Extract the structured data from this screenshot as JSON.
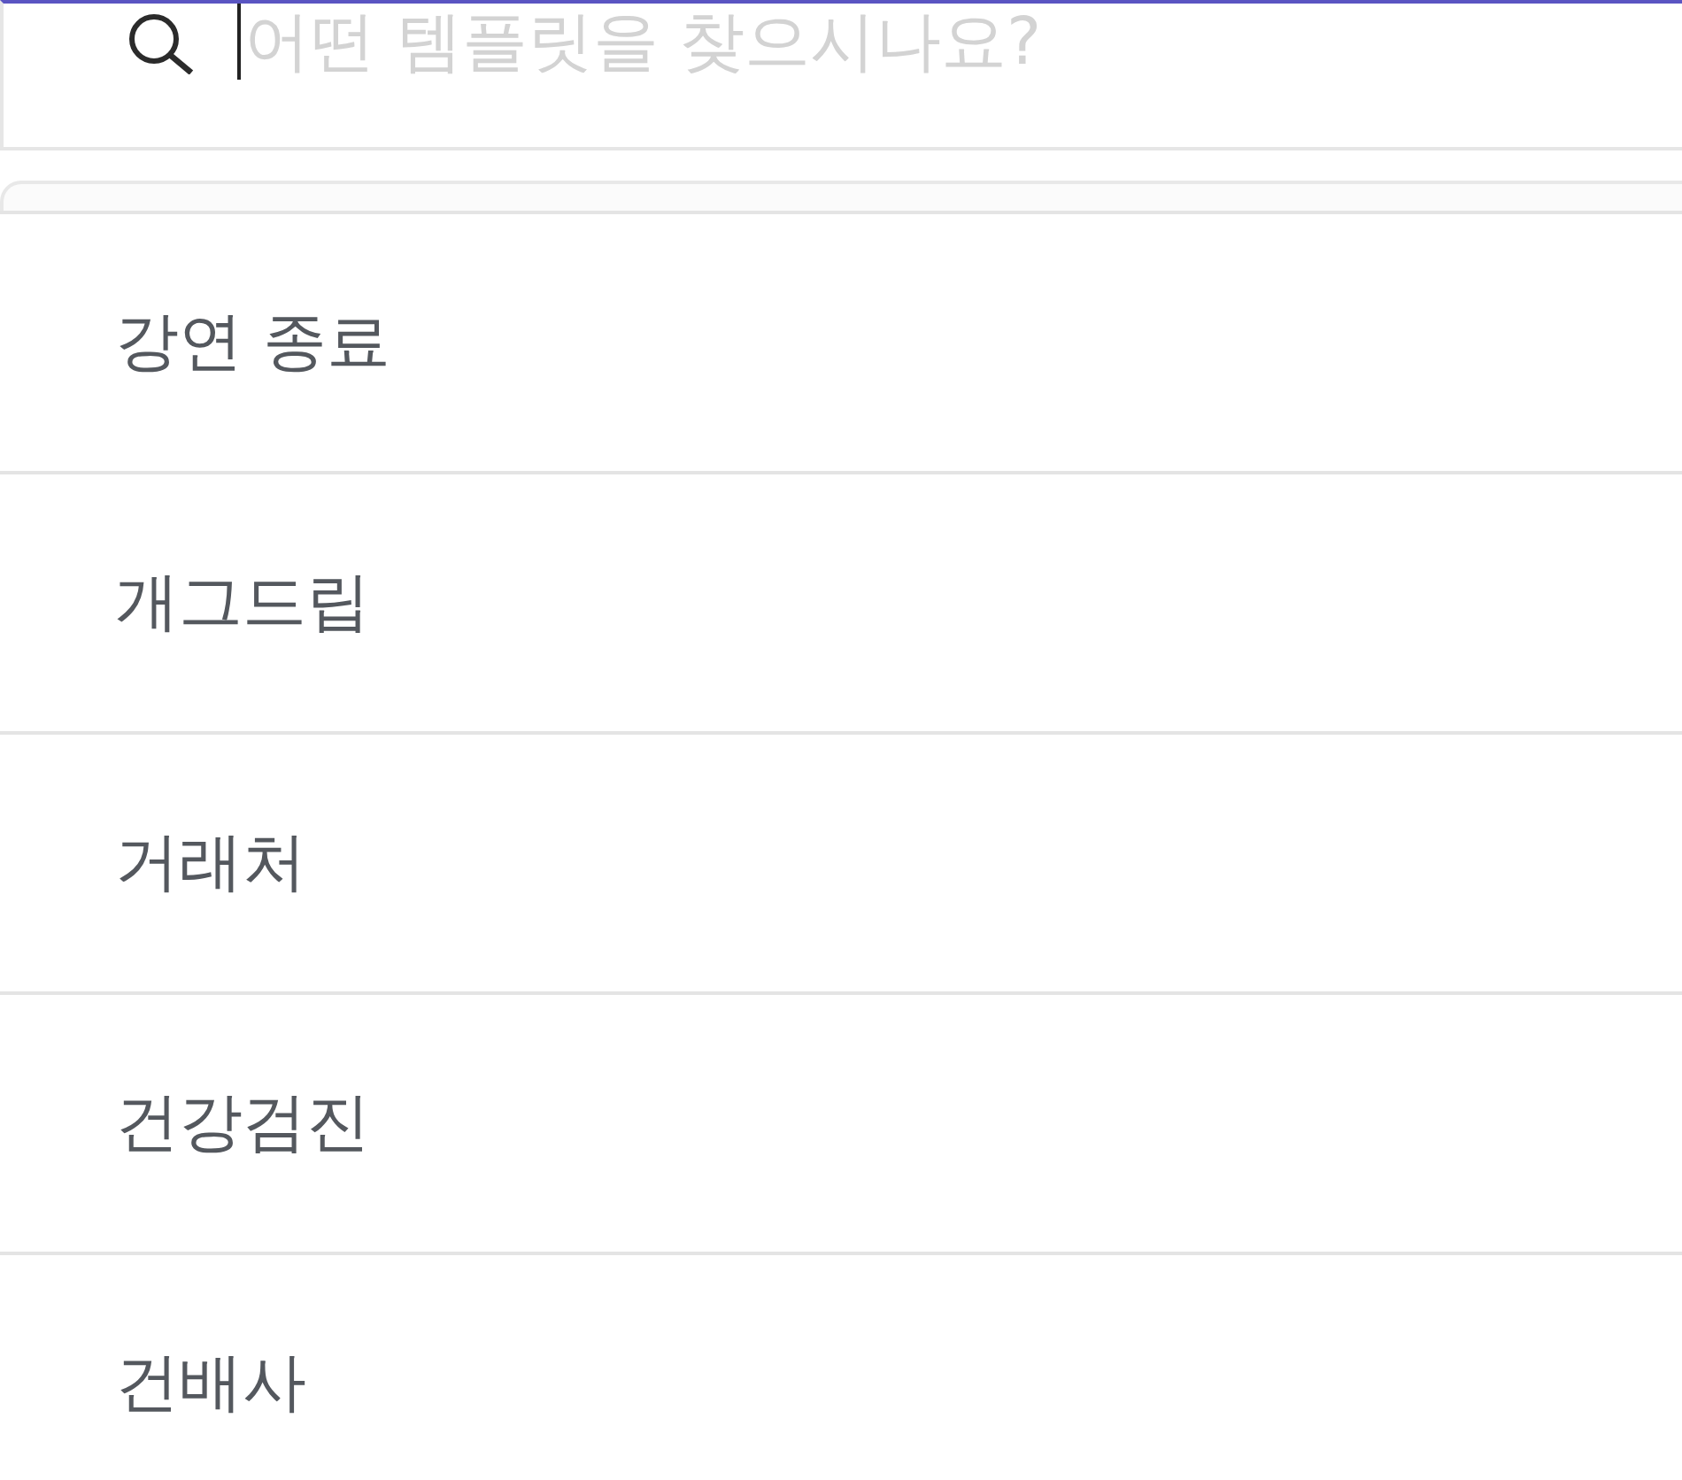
{
  "search": {
    "placeholder": "어떤 템플릿을 찾으시나요?",
    "focused": true
  },
  "suggestions": [
    {
      "label": "강연 종료"
    },
    {
      "label": "개그드립"
    },
    {
      "label": "거래처"
    },
    {
      "label": "건강검진"
    },
    {
      "label": "건배사"
    }
  ]
}
